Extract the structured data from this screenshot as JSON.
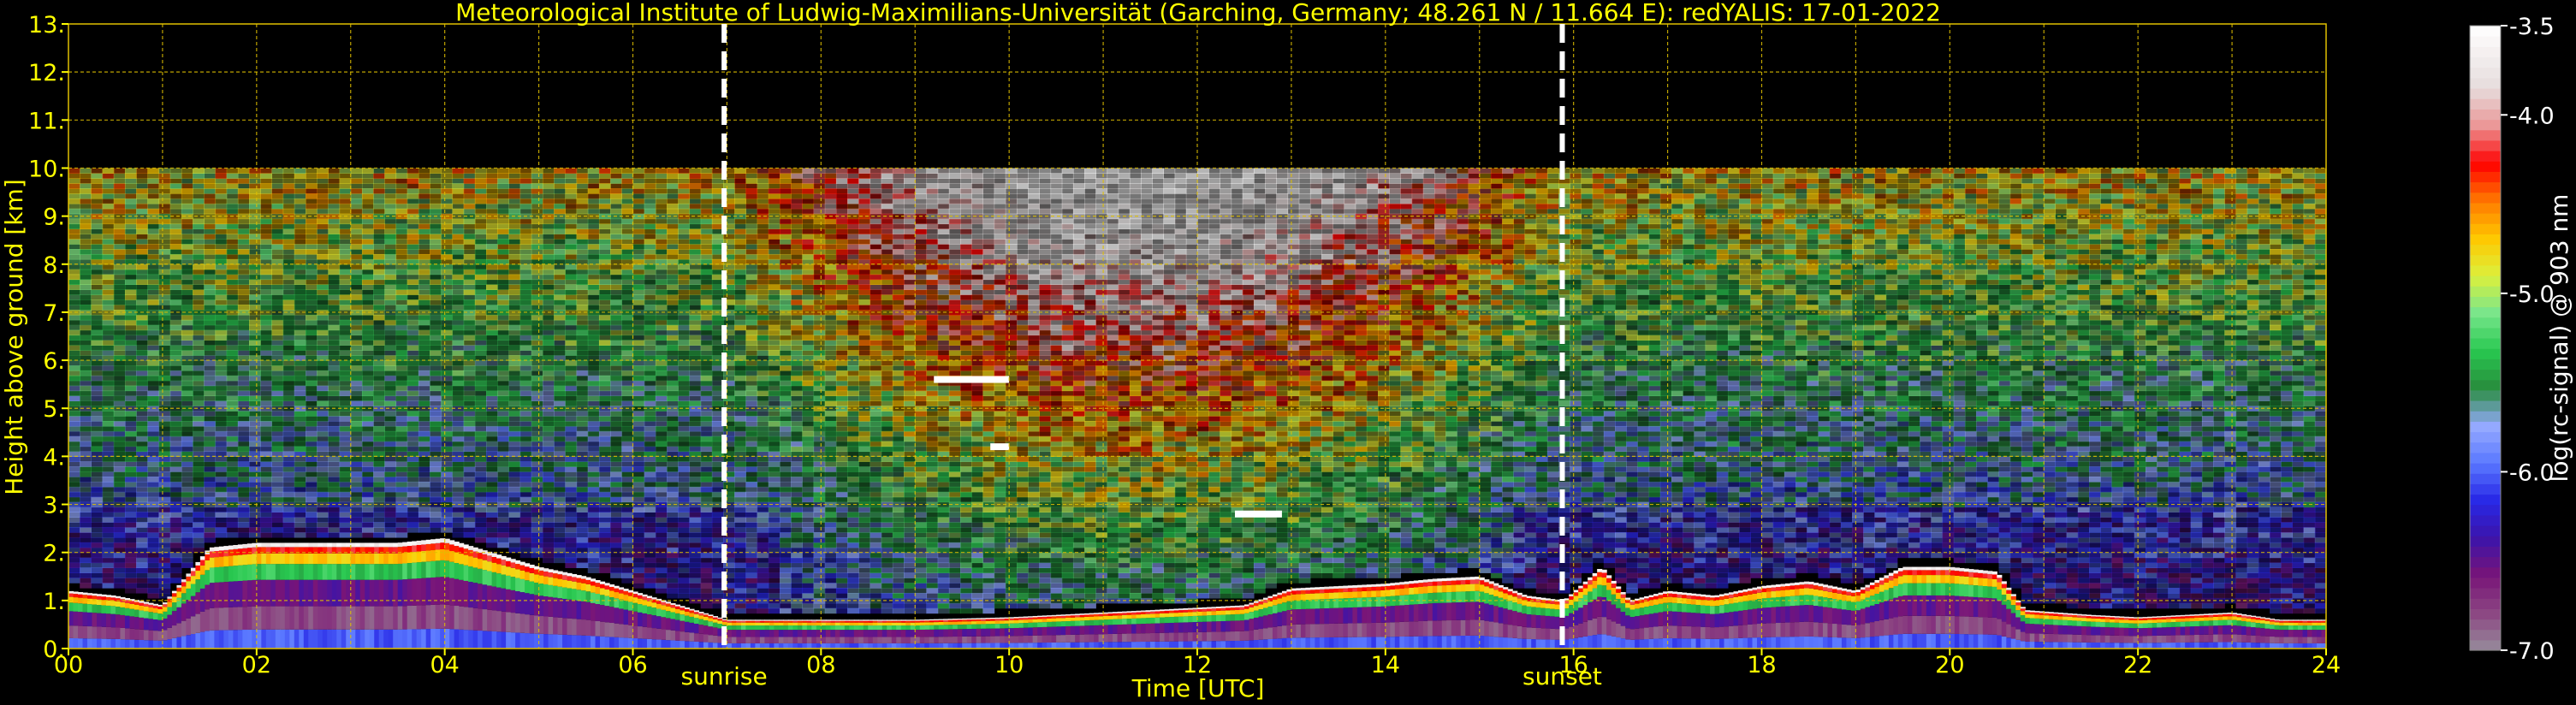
{
  "chart_data": {
    "type": "heatmap",
    "title": "Meteorological Institute of Ludwig-Maximilians-Universität (Garching, Germany; 48.261 N / 11.664 E):    redYALIS: 17-01-2022",
    "xlabel": "Time [UTC]",
    "ylabel": "Height above ground [km]",
    "colorbar_label": "log(rc-signal) @ 903 nm",
    "xlim": [
      0,
      24
    ],
    "ylim": [
      0,
      13
    ],
    "clim": [
      -7.0,
      -3.5
    ],
    "x_ticks": [
      {
        "v": 0,
        "label": "00"
      },
      {
        "v": 2,
        "label": "02"
      },
      {
        "v": 4,
        "label": "04"
      },
      {
        "v": 6,
        "label": "06"
      },
      {
        "v": 8,
        "label": "08"
      },
      {
        "v": 10,
        "label": "10"
      },
      {
        "v": 12,
        "label": "12"
      },
      {
        "v": 14,
        "label": "14"
      },
      {
        "v": 16,
        "label": "16"
      },
      {
        "v": 18,
        "label": "18"
      },
      {
        "v": 20,
        "label": "20"
      },
      {
        "v": 22,
        "label": "22"
      },
      {
        "v": 24,
        "label": "24"
      }
    ],
    "y_ticks": [
      {
        "v": 0,
        "label": "0."
      },
      {
        "v": 1,
        "label": "1."
      },
      {
        "v": 2,
        "label": "2."
      },
      {
        "v": 3,
        "label": "3."
      },
      {
        "v": 4,
        "label": "4."
      },
      {
        "v": 5,
        "label": "5."
      },
      {
        "v": 6,
        "label": "6."
      },
      {
        "v": 7,
        "label": "7."
      },
      {
        "v": 8,
        "label": "8."
      },
      {
        "v": 9,
        "label": "9."
      },
      {
        "v": 10,
        "label": "10."
      },
      {
        "v": 11,
        "label": "11."
      },
      {
        "v": 12,
        "label": "12."
      },
      {
        "v": 13,
        "label": "13."
      }
    ],
    "colorbar_ticks": [
      {
        "v": -3.5,
        "label": "-3.5"
      },
      {
        "v": -4.0,
        "label": "-4.0"
      },
      {
        "v": -5.0,
        "label": "-5.0"
      },
      {
        "v": -6.0,
        "label": "-6.0"
      },
      {
        "v": -7.0,
        "label": "-7.0"
      }
    ],
    "events": [
      {
        "name": "sunrise",
        "x": 6.97
      },
      {
        "name": "sunset",
        "x": 15.88
      }
    ],
    "signal_top_km": 10.0,
    "grid": true,
    "boundary_layer_top": [
      [
        0,
        1.2
      ],
      [
        0.5,
        1.1
      ],
      [
        1.0,
        0.9
      ],
      [
        1.5,
        2.1
      ],
      [
        2.0,
        2.2
      ],
      [
        2.5,
        2.2
      ],
      [
        3.0,
        2.2
      ],
      [
        3.5,
        2.2
      ],
      [
        4.0,
        2.3
      ],
      [
        4.5,
        2.0
      ],
      [
        5.0,
        1.7
      ],
      [
        5.5,
        1.5
      ],
      [
        6.0,
        1.2
      ],
      [
        6.5,
        0.9
      ],
      [
        7.0,
        0.6
      ],
      [
        7.5,
        0.6
      ],
      [
        8.0,
        0.6
      ],
      [
        9.0,
        0.6
      ],
      [
        10.0,
        0.65
      ],
      [
        11.0,
        0.75
      ],
      [
        12.0,
        0.85
      ],
      [
        12.5,
        0.9
      ],
      [
        13.0,
        1.25
      ],
      [
        13.5,
        1.3
      ],
      [
        14.0,
        1.35
      ],
      [
        14.5,
        1.45
      ],
      [
        15.0,
        1.5
      ],
      [
        15.5,
        1.1
      ],
      [
        15.9,
        1.0
      ],
      [
        16.3,
        1.7
      ],
      [
        16.6,
        1.0
      ],
      [
        17.0,
        1.2
      ],
      [
        17.5,
        1.1
      ],
      [
        18.0,
        1.3
      ],
      [
        18.5,
        1.4
      ],
      [
        19.0,
        1.2
      ],
      [
        19.5,
        1.7
      ],
      [
        20.0,
        1.7
      ],
      [
        20.5,
        1.6
      ],
      [
        20.8,
        0.8
      ],
      [
        21.5,
        0.7
      ],
      [
        22.0,
        0.65
      ],
      [
        22.5,
        0.7
      ],
      [
        23.0,
        0.75
      ],
      [
        23.5,
        0.6
      ],
      [
        24.0,
        0.6
      ]
    ],
    "elevated_layers": [
      {
        "x0": 9.2,
        "x1": 10.0,
        "y": 5.6
      },
      {
        "x0": 9.8,
        "x1": 10.0,
        "y": 4.2
      },
      {
        "x0": 12.4,
        "x1": 12.9,
        "y": 2.8
      }
    ],
    "colors": {
      "axis_text": "#ffff00",
      "grid": "#e0c000",
      "background": "#000000",
      "event_line": "#ffffff",
      "colorbar_label": "#ffffff"
    }
  }
}
